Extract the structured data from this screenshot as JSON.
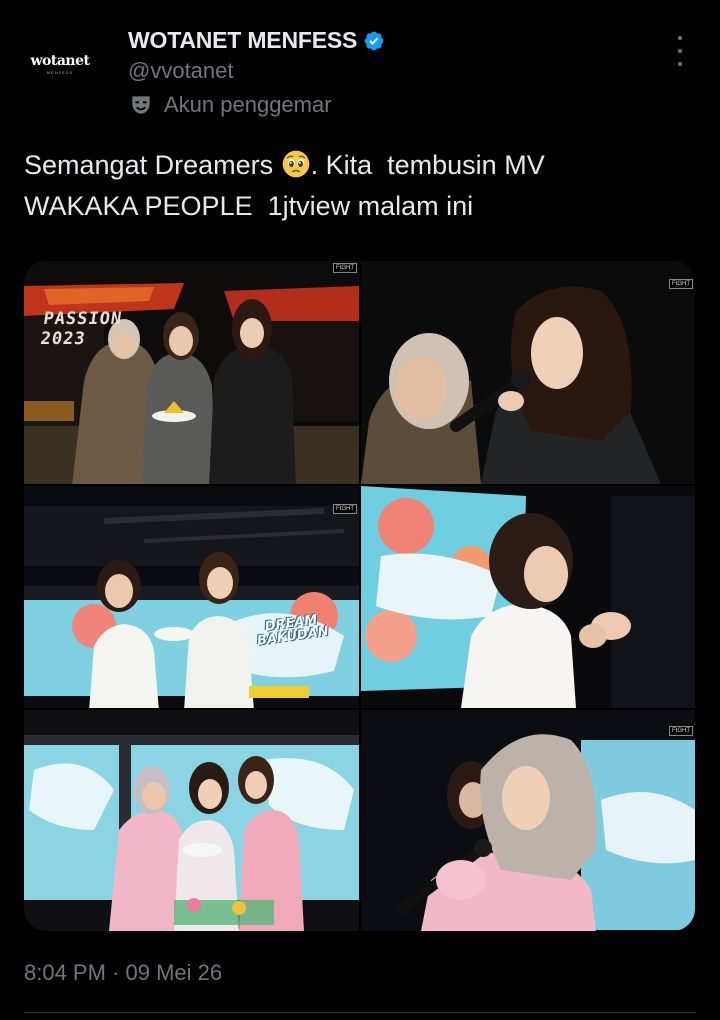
{
  "account": {
    "avatar_logo": "wotanet",
    "avatar_sub": "MENFESS",
    "display_name": "WOTANET MENFESS",
    "handle": "@vvotanet",
    "label": "Akun penggemar",
    "label_icon": "theater-mask-icon",
    "verified_icon": "verified-badge-icon",
    "verified_color": "#1d9bf0"
  },
  "tweet": {
    "line1_before": "Semangat Dreamers ",
    "emoji": "pleading-face-emoji",
    "line1_after": ". Kita  tembusin MV",
    "line2": "WAKAKA PEOPLE  1jtview malam ini"
  },
  "media": {
    "photos": [
      {
        "overlay_text": "PASSION 2023",
        "badge": "FIGHT"
      },
      {
        "badge": "FIGHT"
      },
      {
        "badge": "FIGHT"
      },
      {
        "badge": ""
      },
      {
        "screen_text": "DREAM BAKUDAN",
        "badge": ""
      },
      {
        "badge": "FIGHT"
      }
    ]
  },
  "footer": {
    "time": "8:04 PM",
    "separator": " · ",
    "date": "09 Mei 26"
  },
  "colors": {
    "background": "#000000",
    "text_primary": "#e7e9ea",
    "text_secondary": "#71767b",
    "accent": "#1d9bf0"
  }
}
